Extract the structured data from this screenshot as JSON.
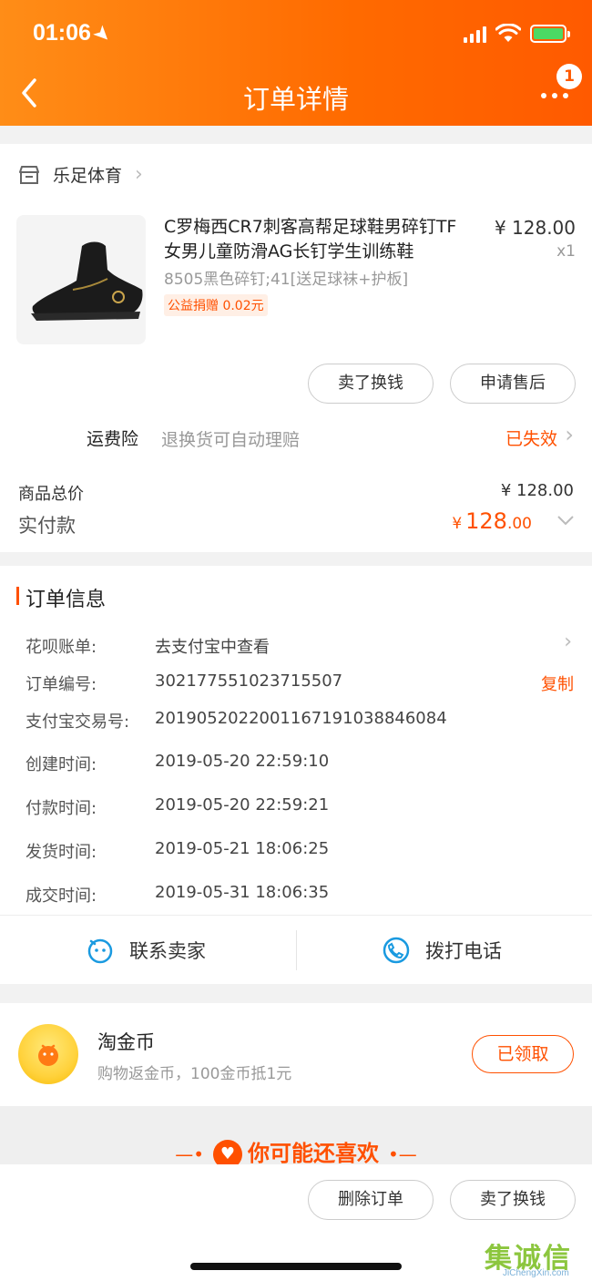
{
  "status_bar": {
    "time": "01:06"
  },
  "header": {
    "title": "订单详情",
    "badge_count": "1"
  },
  "shop": {
    "name": "乐足体育"
  },
  "product": {
    "title": "C罗梅西CR7刺客高帮足球鞋男碎钉TF女男儿童防滑AG长钉学生训练鞋",
    "sku": "8505黑色碎钉;41[送足球袜+护板]",
    "donation_tag": "公益捐赠 0.02元",
    "price": "¥ 128.00",
    "quantity": "x1"
  },
  "item_actions": {
    "sell_label": "卖了换钱",
    "after_sale_label": "申请售后"
  },
  "insurance": {
    "label": "运费险",
    "desc": "退换货可自动理赔",
    "status": "已失效"
  },
  "totals": {
    "goods_label": "商品总价",
    "goods_value": "¥ 128.00",
    "paid_label": "实付款",
    "paid_currency": "¥",
    "paid_int": "128",
    "paid_dec": ".00"
  },
  "order_info": {
    "title": "订单信息",
    "rows": [
      {
        "label": "花呗账单:",
        "value": "去支付宝中查看"
      },
      {
        "label": "订单编号:",
        "value": "302177551023715507",
        "action": "复制"
      },
      {
        "label": "支付宝交易号:",
        "value": "2019052022001167191038846084"
      },
      {
        "label": "创建时间:",
        "value": "2019-05-20 22:59:10"
      },
      {
        "label": "付款时间:",
        "value": "2019-05-20 22:59:21"
      },
      {
        "label": "发货时间:",
        "value": "2019-05-21 18:06:25"
      },
      {
        "label": "成交时间:",
        "value": "2019-05-31 18:06:35"
      }
    ]
  },
  "contact": {
    "seller_label": "联系卖家",
    "phone_label": "拨打电话"
  },
  "coins": {
    "title": "淘金币",
    "desc": "购物返金币，100金币抵1元",
    "button": "已领取"
  },
  "recommend": {
    "title": "你可能还喜欢"
  },
  "bottom_actions": {
    "delete_label": "删除订单",
    "sell_label": "卖了换钱"
  },
  "watermark": {
    "main": "集诚信",
    "sub": "JiChengXin.com"
  },
  "colors": {
    "accent": "#ff5000",
    "header_start": "#ff8d17",
    "header_end": "#ff5a00"
  }
}
